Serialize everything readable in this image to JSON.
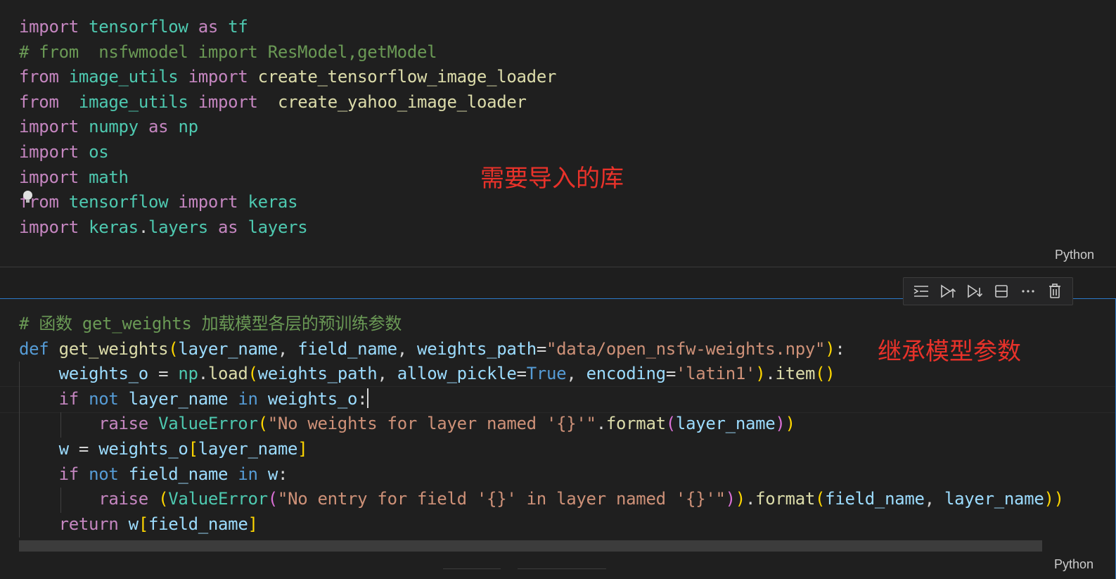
{
  "cell1": {
    "language": "Python",
    "annotation": "需要导入的库",
    "lines": [
      [
        [
          "ctl",
          "import"
        ],
        [
          "plain",
          " "
        ],
        [
          "mod",
          "tensorflow"
        ],
        [
          "plain",
          " "
        ],
        [
          "ctl",
          "as"
        ],
        [
          "plain",
          " "
        ],
        [
          "mod",
          "tf"
        ]
      ],
      [
        [
          "cmt",
          "# from  nsfwmodel import ResModel,getModel"
        ]
      ],
      [
        [
          "ctl",
          "from"
        ],
        [
          "plain",
          " "
        ],
        [
          "mod",
          "image_utils"
        ],
        [
          "plain",
          " "
        ],
        [
          "ctl",
          "import"
        ],
        [
          "plain",
          " "
        ],
        [
          "fn",
          "create_tensorflow_image_loader"
        ]
      ],
      [
        [
          "ctl",
          "from"
        ],
        [
          "plain",
          "  "
        ],
        [
          "mod",
          "image_utils"
        ],
        [
          "plain",
          " "
        ],
        [
          "ctl",
          "import"
        ],
        [
          "plain",
          "  "
        ],
        [
          "fn",
          "create_yahoo_image_loader"
        ]
      ],
      [
        [
          "ctl",
          "import"
        ],
        [
          "plain",
          " "
        ],
        [
          "mod",
          "numpy"
        ],
        [
          "plain",
          " "
        ],
        [
          "ctl",
          "as"
        ],
        [
          "plain",
          " "
        ],
        [
          "mod",
          "np"
        ]
      ],
      [
        [
          "ctl",
          "import"
        ],
        [
          "plain",
          " "
        ],
        [
          "mod",
          "os"
        ]
      ],
      [
        [
          "ctl",
          "import"
        ],
        [
          "plain",
          " "
        ],
        [
          "mod",
          "math"
        ]
      ],
      [
        [
          "ctl",
          "from"
        ],
        [
          "plain",
          " "
        ],
        [
          "mod",
          "tensorflow"
        ],
        [
          "plain",
          " "
        ],
        [
          "ctl",
          "import"
        ],
        [
          "plain",
          " "
        ],
        [
          "mod",
          "keras"
        ]
      ],
      [
        [
          "ctl",
          "import"
        ],
        [
          "plain",
          " "
        ],
        [
          "mod",
          "keras"
        ],
        [
          "plain",
          "."
        ],
        [
          "mod",
          "layers"
        ],
        [
          "plain",
          " "
        ],
        [
          "ctl",
          "as"
        ],
        [
          "plain",
          " "
        ],
        [
          "mod",
          "layers"
        ]
      ]
    ]
  },
  "cell2": {
    "language": "Python",
    "annotation": "继承模型参数",
    "lines": [
      [
        [
          "cmt",
          "# 函数 get_weights 加载模型各层的预训练参数"
        ]
      ],
      [
        [
          "kw",
          "def"
        ],
        [
          "plain",
          " "
        ],
        [
          "fn",
          "get_weights"
        ],
        [
          "p1",
          "("
        ],
        [
          "var",
          "layer_name"
        ],
        [
          "plain",
          ", "
        ],
        [
          "var",
          "field_name"
        ],
        [
          "plain",
          ", "
        ],
        [
          "var",
          "weights_path"
        ],
        [
          "plain",
          "="
        ],
        [
          "str",
          "\"data/open_nsfw-weights.npy\""
        ],
        [
          "p1",
          ")"
        ],
        [
          "plain",
          ":"
        ]
      ],
      [
        [
          "plain",
          "    "
        ],
        [
          "var",
          "weights_o"
        ],
        [
          "plain",
          " = "
        ],
        [
          "mod",
          "np"
        ],
        [
          "plain",
          "."
        ],
        [
          "fn",
          "load"
        ],
        [
          "p1",
          "("
        ],
        [
          "var",
          "weights_path"
        ],
        [
          "plain",
          ", "
        ],
        [
          "var",
          "allow_pickle"
        ],
        [
          "plain",
          "="
        ],
        [
          "kw",
          "True"
        ],
        [
          "plain",
          ", "
        ],
        [
          "var",
          "encoding"
        ],
        [
          "plain",
          "="
        ],
        [
          "str",
          "'latin1'"
        ],
        [
          "p1",
          ")"
        ],
        [
          "plain",
          "."
        ],
        [
          "fn",
          "item"
        ],
        [
          "p1",
          "()"
        ]
      ],
      [
        [
          "plain",
          "    "
        ],
        [
          "ctl",
          "if"
        ],
        [
          "plain",
          " "
        ],
        [
          "kw",
          "not"
        ],
        [
          "plain",
          " "
        ],
        [
          "var",
          "layer_name"
        ],
        [
          "plain",
          " "
        ],
        [
          "kw",
          "in"
        ],
        [
          "plain",
          " "
        ],
        [
          "var",
          "weights_o"
        ],
        [
          "plain",
          ":"
        ]
      ],
      [
        [
          "plain",
          "        "
        ],
        [
          "ctl",
          "raise"
        ],
        [
          "plain",
          " "
        ],
        [
          "mod",
          "ValueError"
        ],
        [
          "p1",
          "("
        ],
        [
          "str",
          "\"No weights for layer named '{}'\""
        ],
        [
          "plain",
          "."
        ],
        [
          "fn",
          "format"
        ],
        [
          "p2",
          "("
        ],
        [
          "var",
          "layer_name"
        ],
        [
          "p2",
          ")"
        ],
        [
          "p1",
          ")"
        ]
      ],
      [
        [
          "plain",
          "    "
        ],
        [
          "var",
          "w"
        ],
        [
          "plain",
          " = "
        ],
        [
          "var",
          "weights_o"
        ],
        [
          "p1",
          "["
        ],
        [
          "var",
          "layer_name"
        ],
        [
          "p1",
          "]"
        ]
      ],
      [
        [
          "plain",
          "    "
        ],
        [
          "ctl",
          "if"
        ],
        [
          "plain",
          " "
        ],
        [
          "kw",
          "not"
        ],
        [
          "plain",
          " "
        ],
        [
          "var",
          "field_name"
        ],
        [
          "plain",
          " "
        ],
        [
          "kw",
          "in"
        ],
        [
          "plain",
          " "
        ],
        [
          "var",
          "w"
        ],
        [
          "plain",
          ":"
        ]
      ],
      [
        [
          "plain",
          "        "
        ],
        [
          "ctl",
          "raise"
        ],
        [
          "plain",
          " "
        ],
        [
          "p1",
          "("
        ],
        [
          "mod",
          "ValueError"
        ],
        [
          "p2",
          "("
        ],
        [
          "str",
          "\"No entry for field '{}' in layer named '{}'\""
        ],
        [
          "p2",
          ")"
        ],
        [
          "p1",
          ")"
        ],
        [
          "plain",
          "."
        ],
        [
          "fn",
          "format"
        ],
        [
          "p1",
          "("
        ],
        [
          "var",
          "field_name"
        ],
        [
          "plain",
          ", "
        ],
        [
          "var",
          "layer_name"
        ],
        [
          "p1",
          ")"
        ],
        [
          "p1",
          ")"
        ]
      ],
      [
        [
          "plain",
          "    "
        ],
        [
          "ctl",
          "return"
        ],
        [
          "plain",
          " "
        ],
        [
          "var",
          "w"
        ],
        [
          "p1",
          "["
        ],
        [
          "var",
          "field_name"
        ],
        [
          "p1",
          "]"
        ]
      ]
    ]
  },
  "toolbar": {
    "buttons": [
      {
        "name": "execute-above-cells-icon",
        "label": "Execute Above Cells"
      },
      {
        "name": "run-cell-and-above-icon",
        "label": "Run Cell and Above"
      },
      {
        "name": "run-cell-and-below-icon",
        "label": "Run Cell and Below"
      },
      {
        "name": "split-cell-icon",
        "label": "Split Cell"
      },
      {
        "name": "more-actions-icon",
        "label": "More Actions"
      },
      {
        "name": "delete-cell-icon",
        "label": "Delete Cell"
      }
    ]
  }
}
